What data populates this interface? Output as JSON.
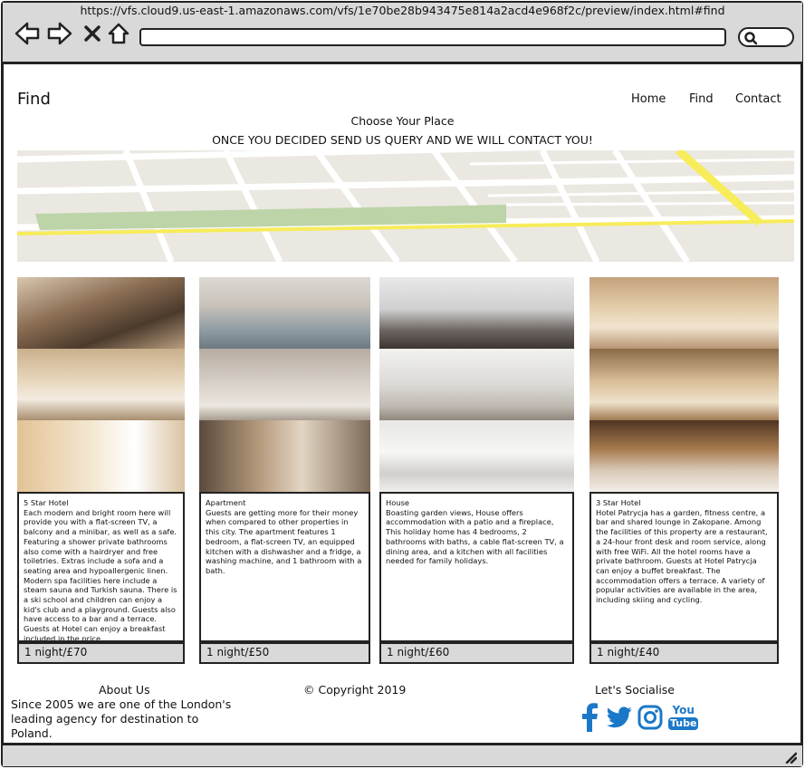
{
  "browser": {
    "url": "https://vfs.cloud9.us-east-1.amazonaws.com/vfs/1e70be28b943475e814a2acd4e968f2c/preview/index.html#find"
  },
  "header": {
    "brand": "Find",
    "nav": [
      "Home",
      "Find",
      "Contact"
    ]
  },
  "hero": {
    "title": "Choose Your Place",
    "subtitle": "ONCE YOU DECIDED SEND US QUERY AND WE WILL CONTACT YOU!"
  },
  "listings": [
    {
      "title": "5 Star Hotel",
      "description": "Each modern and bright room here will provide you with a flat-screen TV, a balcony and a minibar, as well as a safe. Featuring a shower private bathrooms also come with a hairdryer and free toiletries. Extras include a sofa and a seating area and hypoallergenic linen. Modern spa facilities here include a steam sauna and Turkish sauna. There is a ski school and children can enjoy a kid's club and a playground. Guests also have access to a bar and a terrace. Guests at Hotel can enjoy a breakfast included in the price.",
      "price": "1 night/£70"
    },
    {
      "title": "Apartment",
      "description": "Guests are getting more for their money when compared to other properties in this city. The apartment features 1 bedroom, a flat-screen TV, an equipped kitchen with a dishwasher and a fridge, a washing machine, and 1 bathroom with a bath.",
      "price": "1 night/£50"
    },
    {
      "title": "House",
      "description": "Boasting garden views, House offers accommodation with a patio and a fireplace, This holiday home has 4 bedrooms, 2 bathrooms with baths, a cable flat-screen TV, a dining area, and a kitchen with all facilities needed for family holidays.",
      "price": "1 night/£60"
    },
    {
      "title": "3 Star Hotel",
      "description": "Hotel Patrycja has a garden, fitness centre, a bar and shared lounge in Zakopane. Among the facilities of this property are a restaurant, a 24-hour front desk and room service, along with free WiFi. All the hotel rooms have a private bathroom. Guests at Hotel Patrycja can enjoy a buffet breakfast. The accommodation offers a terrace. A variety of popular activities are available in the area, including skiing and cycling.",
      "price": "1 night/£40"
    }
  ],
  "footer": {
    "about_title": "About Us",
    "about_text": "Since 2005 we are one of the London's leading agency for destination to Poland.",
    "copyright": "© Copyright 2019",
    "social_title": "Let's Socialise",
    "social_icons": [
      "facebook-icon",
      "twitter-icon",
      "instagram-icon",
      "youtube-icon"
    ],
    "youtube_label_top": "You",
    "youtube_label_bottom": "Tube"
  },
  "colors": {
    "chrome": "#d9d9d9",
    "social_blue": "#1b78c8",
    "map_road_yellow": "#f7ec5a",
    "map_green": "#bcd4a8"
  }
}
